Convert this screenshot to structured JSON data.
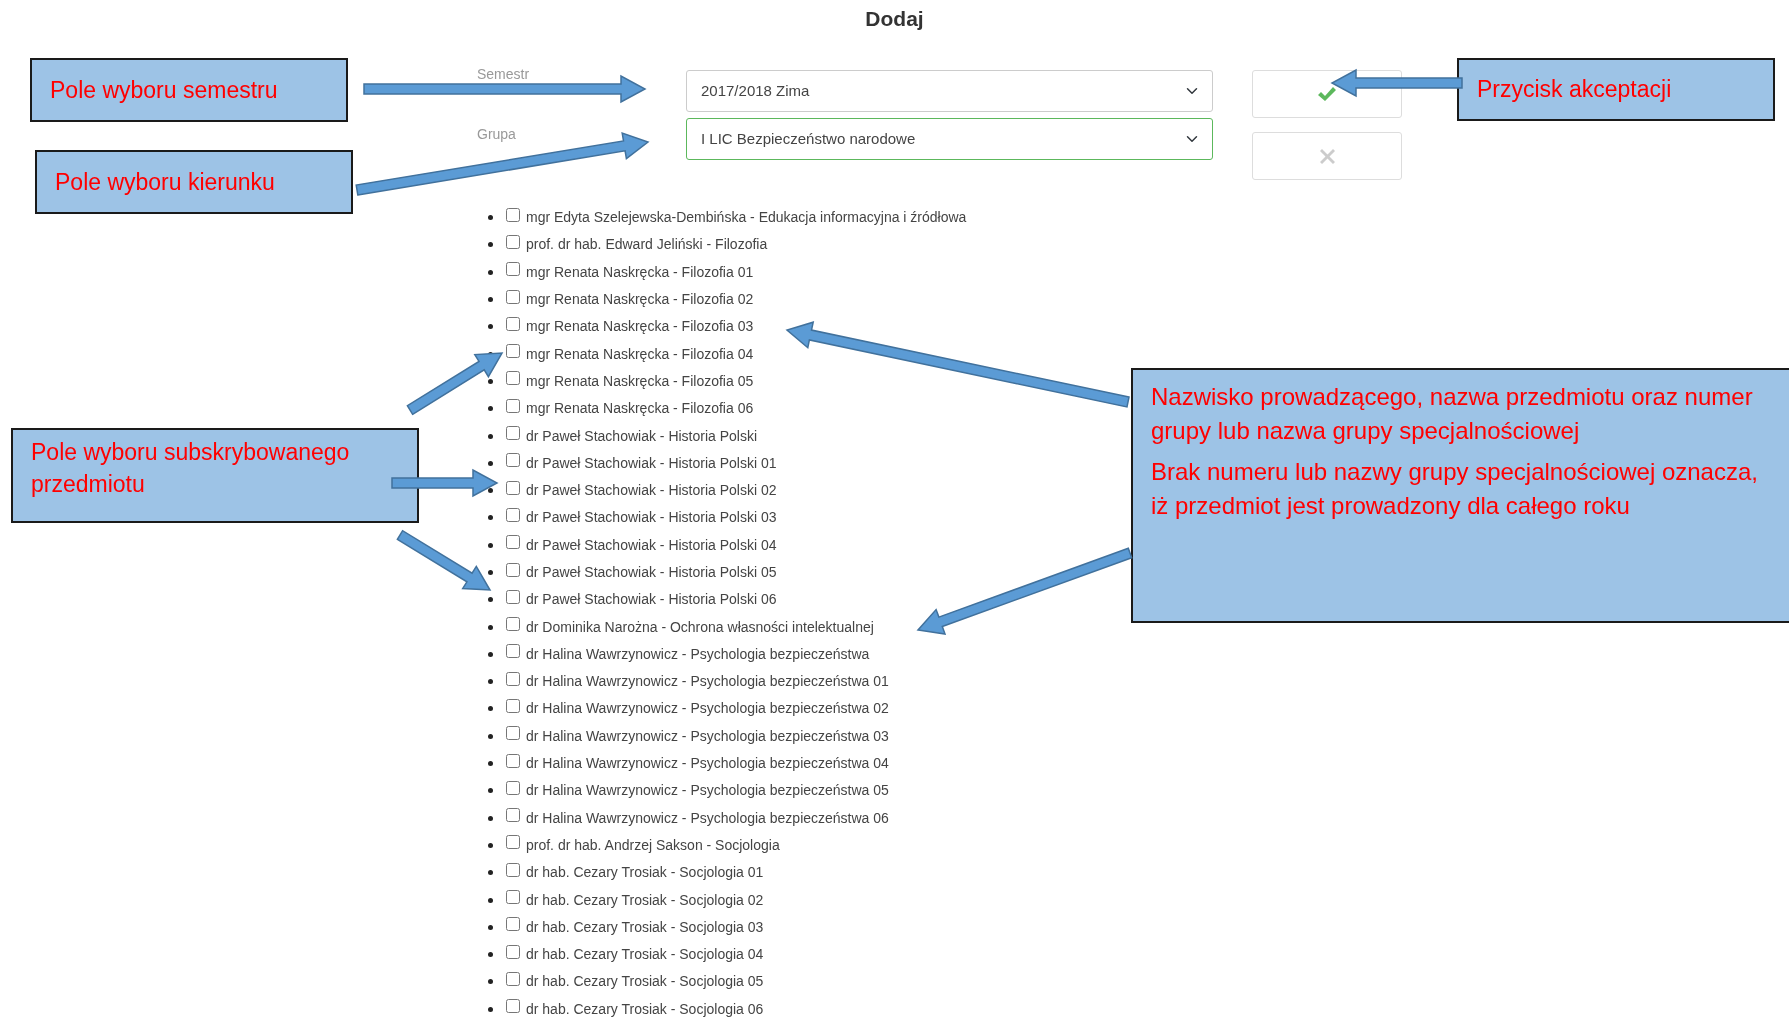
{
  "title": "Dodaj",
  "form": {
    "fields": [
      {
        "label": "Semestr",
        "value": "2017/2018 Zima",
        "focused": false
      },
      {
        "label": "Grupa",
        "value": "I LIC Bezpieczeństwo narodowe",
        "focused": true
      }
    ],
    "buttons": [
      {
        "kind": "accept"
      },
      {
        "kind": "cancel"
      }
    ]
  },
  "subjects": [
    {
      "label": "mgr Edyta Szelejewska-Dembińska - Edukacja informacyjna i źródłowa",
      "checked": false
    },
    {
      "label": "prof. dr hab. Edward Jeliński - Filozofia",
      "checked": false
    },
    {
      "label": "mgr Renata Naskręcka - Filozofia 01",
      "checked": false
    },
    {
      "label": "mgr Renata Naskręcka - Filozofia 02",
      "checked": false
    },
    {
      "label": "mgr Renata Naskręcka - Filozofia 03",
      "checked": false
    },
    {
      "label": "mgr Renata Naskręcka - Filozofia 04",
      "checked": false
    },
    {
      "label": "mgr Renata Naskręcka - Filozofia 05",
      "checked": false
    },
    {
      "label": "mgr Renata Naskręcka - Filozofia 06",
      "checked": false
    },
    {
      "label": "dr Paweł Stachowiak - Historia Polski",
      "checked": false
    },
    {
      "label": "dr Paweł Stachowiak - Historia Polski 01",
      "checked": false
    },
    {
      "label": "dr Paweł Stachowiak - Historia Polski 02",
      "checked": false
    },
    {
      "label": "dr Paweł Stachowiak - Historia Polski 03",
      "checked": false
    },
    {
      "label": "dr Paweł Stachowiak - Historia Polski 04",
      "checked": false
    },
    {
      "label": "dr Paweł Stachowiak - Historia Polski 05",
      "checked": false
    },
    {
      "label": "dr Paweł Stachowiak - Historia Polski 06",
      "checked": false
    },
    {
      "label": "dr Dominika Narożna - Ochrona własności intelektualnej",
      "checked": false
    },
    {
      "label": "dr Halina Wawrzynowicz - Psychologia bezpieczeństwa",
      "checked": false
    },
    {
      "label": "dr Halina Wawrzynowicz - Psychologia bezpieczeństwa 01",
      "checked": false
    },
    {
      "label": "dr Halina Wawrzynowicz - Psychologia bezpieczeństwa 02",
      "checked": false
    },
    {
      "label": "dr Halina Wawrzynowicz - Psychologia bezpieczeństwa 03",
      "checked": false
    },
    {
      "label": "dr Halina Wawrzynowicz - Psychologia bezpieczeństwa 04",
      "checked": false
    },
    {
      "label": "dr Halina Wawrzynowicz - Psychologia bezpieczeństwa 05",
      "checked": false
    },
    {
      "label": "dr Halina Wawrzynowicz - Psychologia bezpieczeństwa 06",
      "checked": false
    },
    {
      "label": "prof. dr hab. Andrzej Sakson - Socjologia",
      "checked": false
    },
    {
      "label": "dr hab. Cezary Trosiak - Socjologia 01",
      "checked": false
    },
    {
      "label": "dr hab. Cezary Trosiak - Socjologia 02",
      "checked": false
    },
    {
      "label": "dr hab. Cezary Trosiak - Socjologia 03",
      "checked": false
    },
    {
      "label": "dr hab. Cezary Trosiak - Socjologia 04",
      "checked": false
    },
    {
      "label": "dr hab. Cezary Trosiak - Socjologia 05",
      "checked": false
    },
    {
      "label": "dr hab. Cezary Trosiak - Socjologia 06",
      "checked": false
    }
  ],
  "callouts": [
    {
      "paragraphs": [
        "Pole wyboru semestru"
      ]
    },
    {
      "paragraphs": [
        "Pole wyboru kierunku"
      ]
    },
    {
      "paragraphs": [
        "Przycisk akceptacji"
      ]
    },
    {
      "paragraphs": [
        "Pole wyboru subskrybowanego przedmiotu"
      ]
    },
    {
      "paragraphs": [
        "Nazwisko prowadzącego, nazwa przedmiotu oraz numer grupy lub nazwa grupy specjalnościowej",
        "Brak numeru lub nazwy grupy specjalnościowej oznacza, iż przedmiot jest prowadzony dla całego roku"
      ]
    }
  ]
}
